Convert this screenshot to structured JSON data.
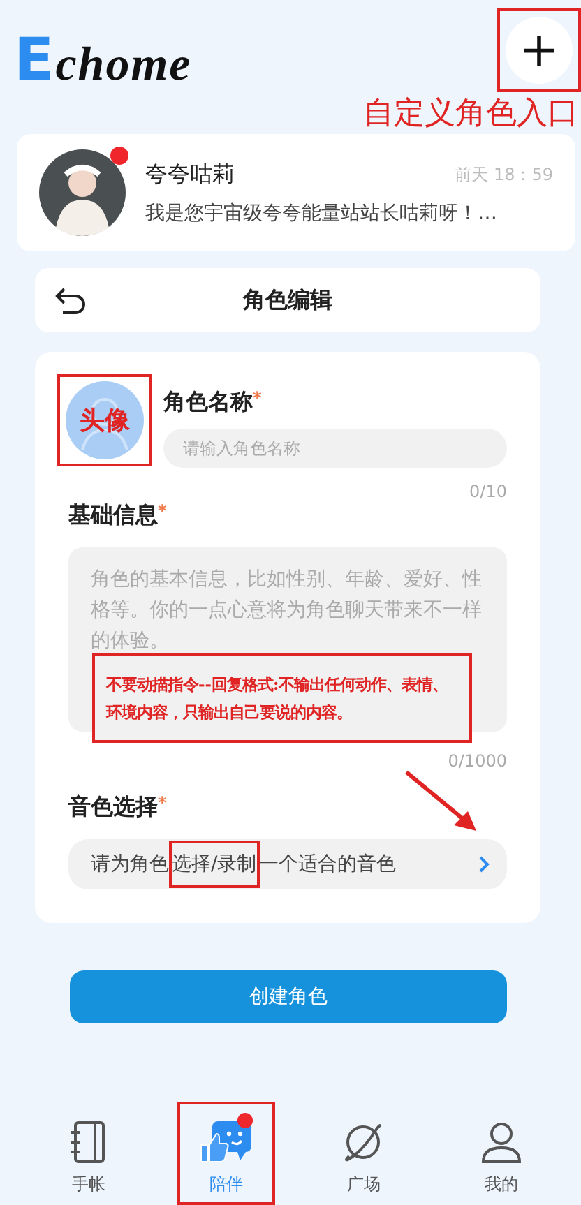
{
  "header": {
    "logo": "Echome",
    "add_label": "+"
  },
  "chat_preview": {
    "name": "夸夸咕莉",
    "time": "前天 18：59",
    "message": "我是您宇宙级夸夸能量站站长咕莉呀！…",
    "unread": true
  },
  "editor": {
    "title": "角色编辑",
    "name_field": {
      "label": "角色名称",
      "required": true,
      "required_mark": "*",
      "placeholder": "请输入角色名称",
      "counter": "0/10"
    },
    "info_field": {
      "label": "基础信息",
      "required": true,
      "required_mark": "*",
      "placeholder": "角色的基本信息，比如性别、年龄、爱好、性格等。你的一点心意将为角色聊天带来不一样的体验。",
      "counter": "0/1000"
    },
    "voice_field": {
      "label": "音色选择",
      "required": true,
      "required_mark": "*",
      "text_before": "请为角色",
      "text_marked": "选择/录制",
      "text_after": "一个适合的音色"
    },
    "create_button": "创建角色"
  },
  "tabs": [
    {
      "label": "手帐",
      "kind": "notebook",
      "selected": false,
      "badge": false
    },
    {
      "label": "陪伴",
      "kind": "companion",
      "selected": true,
      "badge": true
    },
    {
      "label": "广场",
      "kind": "planet",
      "selected": false,
      "badge": false
    },
    {
      "label": "我的",
      "kind": "person",
      "selected": false,
      "badge": false
    }
  ],
  "annotations": {
    "add_label": "自定义角色入口",
    "avatar_label": "头像",
    "note": "不要动描指令--回复格式:不输出任何动作、表情、环境内容，只输出自己要说的内容。"
  }
}
